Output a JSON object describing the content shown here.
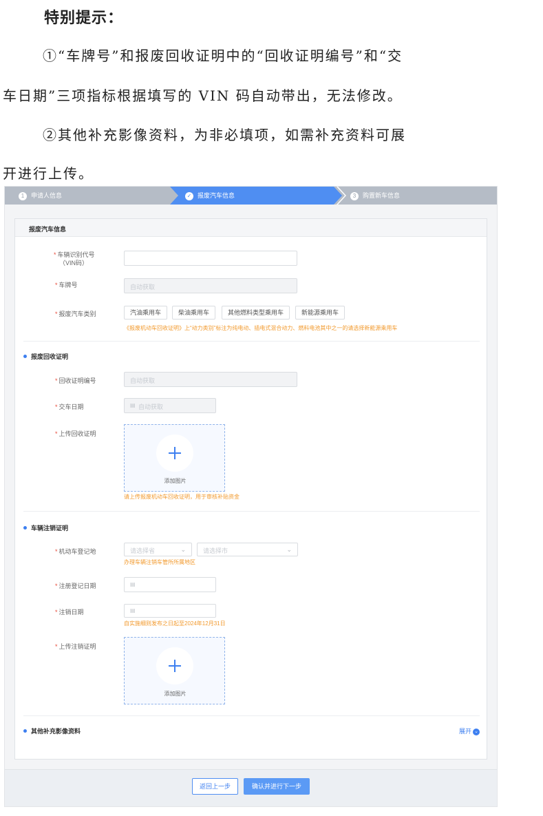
{
  "notice": {
    "heading": "特别提示：",
    "line1": "①“车牌号”和报废回收证明中的“回收证明编号”和“交",
    "line2": "车日期”三项指标根据填写的 VIN 码自动带出，无法修改。",
    "line3": "②其他补充影像资料，为非必填项，如需补充资料可展",
    "line4": "开进行上传。"
  },
  "steps": [
    {
      "num": "1",
      "label": "申请人信息"
    },
    {
      "num": "✓",
      "label": "报废汽车信息"
    },
    {
      "num": "3",
      "label": "购置新车信息"
    }
  ],
  "card_title": "报废汽车信息",
  "fields": {
    "vin_label": "车辆识别代号",
    "vin_label2": "（VIN码）",
    "plate_label": "车牌号",
    "plate_placeholder": "自动获取",
    "type_label": "报废汽车类别",
    "type_options": [
      "汽油乘用车",
      "柴油乘用车",
      "其他燃料类型乘用车",
      "新能源乘用车"
    ],
    "type_hint": "《报废机动车回收证明》上“动力类别”标注为纯电动、插电式混合动力、燃料电池其中之一的请选择新能源乘用车"
  },
  "recycle": {
    "title": "报废回收证明",
    "cert_no_label": "回收证明编号",
    "cert_no_placeholder": "自动获取",
    "handover_label": "交车日期",
    "handover_placeholder": "自动获取",
    "upload_label": "上传回收证明",
    "upload_text": "添加图片",
    "upload_hint": "请上传报废机动车回收证明，用于审核补贴资金"
  },
  "dereg": {
    "title": "车辆注销证明",
    "region_label": "机动车登记地",
    "province_placeholder": "请选择省",
    "city_placeholder": "请选择市",
    "region_hint": "办理车辆注销车管所所属地区",
    "reg_date_label": "注册登记日期",
    "cancel_date_label": "注销日期",
    "cancel_hint": "自实施细则发布之日起至2024年12月31日",
    "upload_label": "上传注销证明",
    "upload_text": "添加图片"
  },
  "supplement": {
    "title": "其他补充影像资料",
    "expand": "展开"
  },
  "buttons": {
    "back": "返回上一步",
    "next": "确认并进行下一步"
  },
  "colors": {
    "primary": "#3d7ff0",
    "required": "#e74c3c",
    "hint": "#f29a2e"
  },
  "icons": {
    "calendar": "calendar-icon",
    "chevron": "chevron-down-icon",
    "plus": "plus-icon"
  }
}
